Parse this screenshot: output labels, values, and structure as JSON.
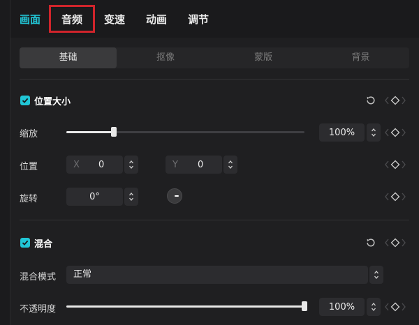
{
  "tabs": [
    {
      "label": "画面",
      "active": true
    },
    {
      "label": "音频",
      "active": false,
      "highlighted": true
    },
    {
      "label": "变速",
      "active": false
    },
    {
      "label": "动画",
      "active": false
    },
    {
      "label": "调节",
      "active": false
    }
  ],
  "subtabs": [
    {
      "label": "基础",
      "active": true
    },
    {
      "label": "抠像",
      "active": false
    },
    {
      "label": "蒙版",
      "active": false
    },
    {
      "label": "背景",
      "active": false
    }
  ],
  "position_size": {
    "title": "位置大小",
    "checked": true,
    "scale": {
      "label": "缩放",
      "value": "100%",
      "slider_percent": 20
    },
    "position": {
      "label": "位置",
      "x_label": "X",
      "x_value": "0",
      "y_label": "Y",
      "y_value": "0"
    },
    "rotation": {
      "label": "旋转",
      "value": "0°"
    }
  },
  "blend": {
    "title": "混合",
    "checked": true,
    "mode": {
      "label": "混合模式",
      "value": "正常"
    },
    "opacity": {
      "label": "不透明度",
      "value": "100%",
      "slider_percent": 100
    }
  },
  "colors": {
    "accent": "#21c6d6",
    "highlight_box": "#d0242b",
    "background": "#1f1f21"
  }
}
